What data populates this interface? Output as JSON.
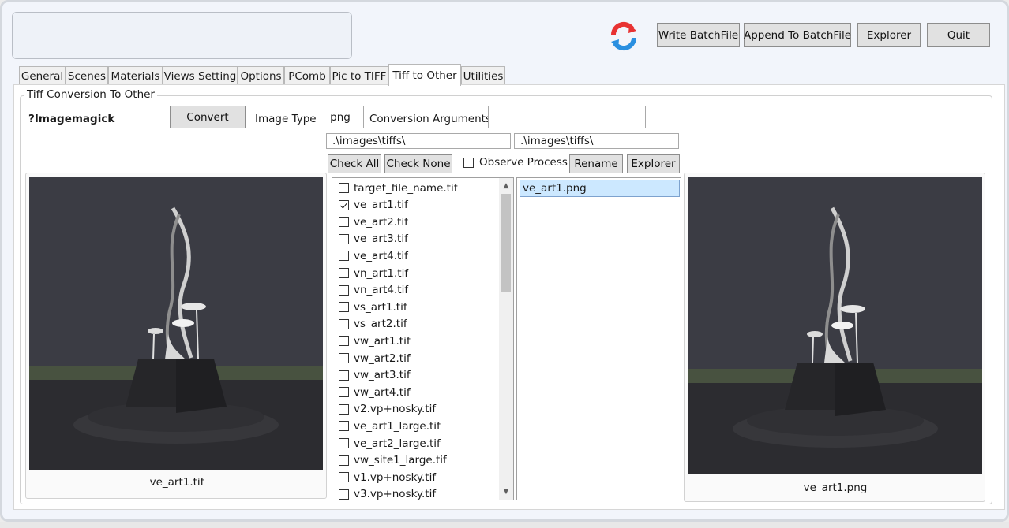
{
  "toolbar": {
    "write_batch": "Write BatchFile",
    "append_batch": "Append To BatchFile",
    "explorer": "Explorer",
    "quit": "Quit",
    "logo_icon": "sync-arrows-icon",
    "logo_colors": [
      "#e83232",
      "#2a8fe0"
    ]
  },
  "tabs": [
    {
      "label": "General"
    },
    {
      "label": "Scenes"
    },
    {
      "label": "Materials"
    },
    {
      "label": "Views Setting"
    },
    {
      "label": "Options"
    },
    {
      "label": "PComb"
    },
    {
      "label": "Pic to TIFF"
    },
    {
      "label": "Tiff to Other",
      "active": true
    },
    {
      "label": "Utilities"
    }
  ],
  "group": {
    "title": "Tiff Conversion To Other",
    "tool_label": "?Imagemagick",
    "convert_button": "Convert",
    "image_type_label": "Image Type:",
    "image_type_value": "png",
    "conversion_args_label": "Conversion Arguments:",
    "conversion_args_value": "",
    "source_path": ".\\images\\tiffs\\",
    "target_path": ".\\images\\tiffs\\",
    "check_all": "Check All",
    "check_none": "Check None",
    "observe_process": "Observe Process",
    "observe_checked": false,
    "rename": "Rename",
    "explorer": "Explorer"
  },
  "files": [
    {
      "name": "target_file_name.tif",
      "checked": false
    },
    {
      "name": "ve_art1.tif",
      "checked": true
    },
    {
      "name": "ve_art2.tif",
      "checked": false
    },
    {
      "name": "ve_art3.tif",
      "checked": false
    },
    {
      "name": "ve_art4.tif",
      "checked": false
    },
    {
      "name": "vn_art1.tif",
      "checked": false
    },
    {
      "name": "vn_art4.tif",
      "checked": false
    },
    {
      "name": "vs_art1.tif",
      "checked": false
    },
    {
      "name": "vs_art2.tif",
      "checked": false
    },
    {
      "name": "vw_art1.tif",
      "checked": false
    },
    {
      "name": "vw_art2.tif",
      "checked": false
    },
    {
      "name": "vw_art3.tif",
      "checked": false
    },
    {
      "name": "vw_art4.tif",
      "checked": false
    },
    {
      "name": "v2.vp+nosky.tif",
      "checked": false
    },
    {
      "name": "ve_art1_large.tif",
      "checked": false
    },
    {
      "name": "ve_art2_large.tif",
      "checked": false
    },
    {
      "name": "vw_site1_large.tif",
      "checked": false
    },
    {
      "name": "v1.vp+nosky.tif",
      "checked": false
    },
    {
      "name": "v3.vp+nosky.tif",
      "checked": false
    }
  ],
  "output_files": [
    {
      "name": "ve_art1.png",
      "selected": true
    }
  ],
  "previews": {
    "left_caption": "ve_art1.tif",
    "right_caption": "ve_art1.png"
  }
}
